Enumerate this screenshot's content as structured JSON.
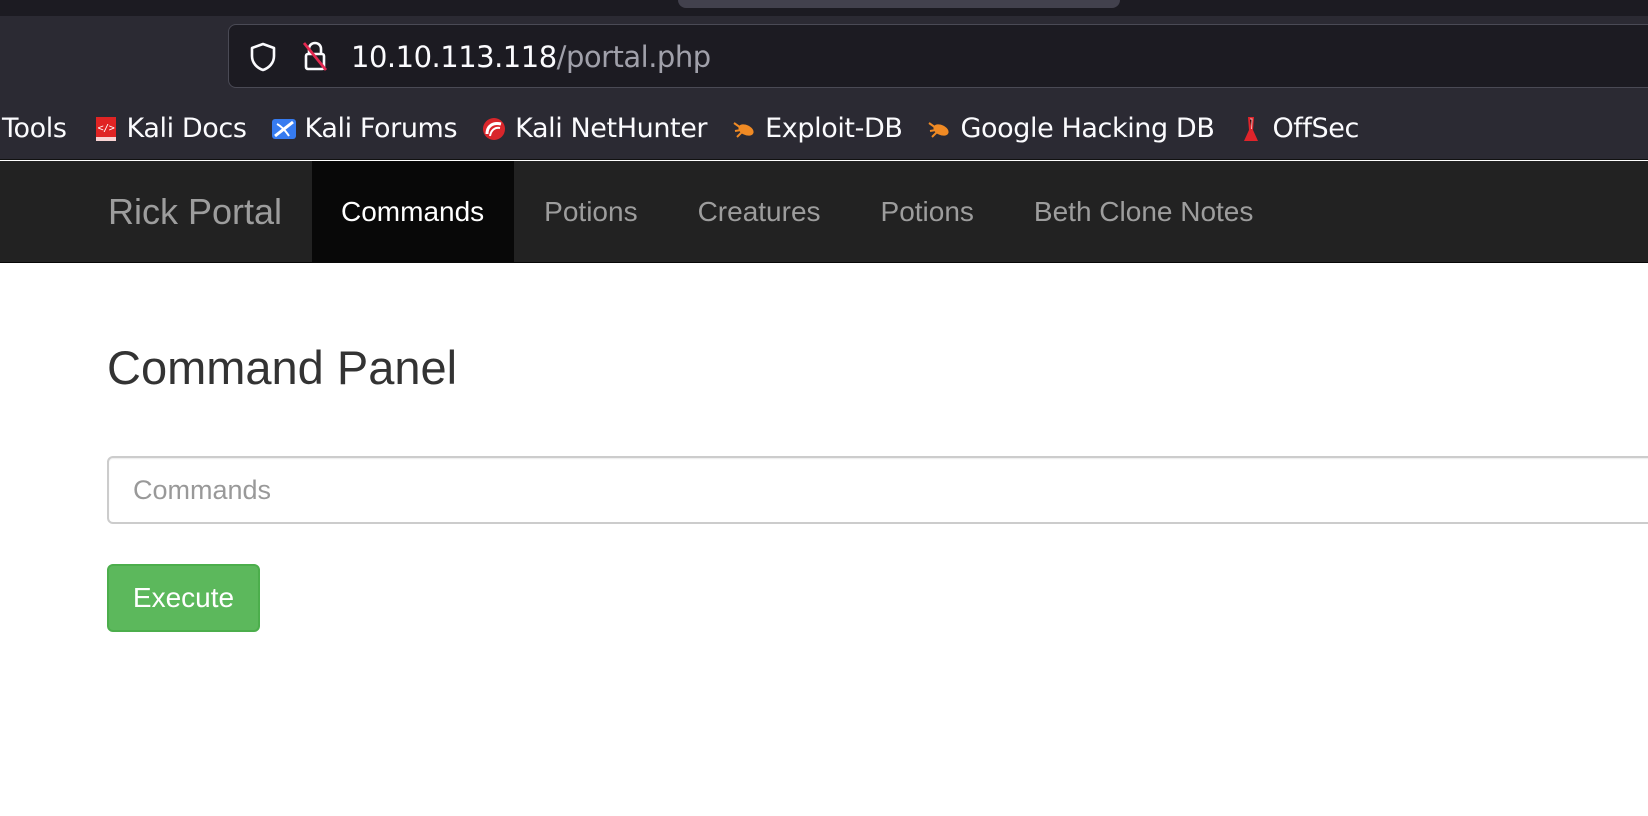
{
  "browser": {
    "url": {
      "host": "10.10.113.118",
      "path": "/portal.php"
    },
    "bookmarks": [
      {
        "label": "Tools",
        "icon": ""
      },
      {
        "label": "Kali Docs",
        "icon": "kali-docs-icon"
      },
      {
        "label": "Kali Forums",
        "icon": "kali-forums-icon"
      },
      {
        "label": "Kali NetHunter",
        "icon": "kali-nethunter-icon"
      },
      {
        "label": "Exploit-DB",
        "icon": "exploit-db-icon"
      },
      {
        "label": "Google Hacking DB",
        "icon": "google-hacking-db-icon"
      },
      {
        "label": "OffSec",
        "icon": "offsec-icon"
      }
    ]
  },
  "site": {
    "brand": "Rick Portal",
    "nav": [
      {
        "label": "Commands",
        "active": true
      },
      {
        "label": "Potions",
        "active": false
      },
      {
        "label": "Creatures",
        "active": false
      },
      {
        "label": "Potions",
        "active": false
      },
      {
        "label": "Beth Clone Notes",
        "active": false
      }
    ]
  },
  "main": {
    "title": "Command Panel",
    "command_placeholder": "Commands",
    "command_value": "",
    "execute_label": "Execute"
  },
  "colors": {
    "nav_bg": "#222222",
    "nav_active_bg": "#080808",
    "button_success": "#5cb85c",
    "browser_chrome": "#2b2a33"
  }
}
